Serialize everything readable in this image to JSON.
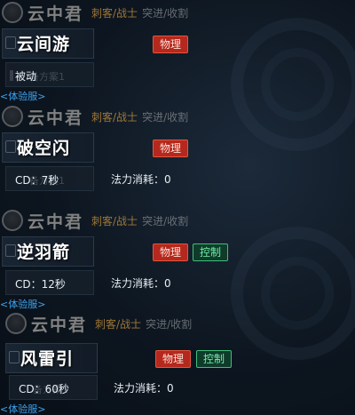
{
  "hero": {
    "name": "云中君",
    "role": "刺客/战士",
    "position": "突进/收割"
  },
  "trial_label": "<体验服>",
  "ghost_text": "备方案1",
  "skills": [
    {
      "name": "云间游",
      "tags": [
        "物理"
      ],
      "info": "被动",
      "cost": ""
    },
    {
      "name": "破空闪",
      "tags": [
        "物理"
      ],
      "info": "CD：7秒",
      "cost": "法力消耗：0"
    },
    {
      "name": "逆羽箭",
      "tags": [
        "物理",
        "控制"
      ],
      "info": "CD：12秒",
      "cost": "法力消耗：0"
    },
    {
      "name": "风雷引",
      "tags": [
        "物理",
        "控制"
      ],
      "info": "CD：60秒",
      "cost": "法力消耗：0"
    }
  ],
  "colors": {
    "tag_physical": "#b4281e",
    "tag_control": "#0f3b2a",
    "trial_link": "#3da3ee",
    "role_text": "#cd963c"
  }
}
